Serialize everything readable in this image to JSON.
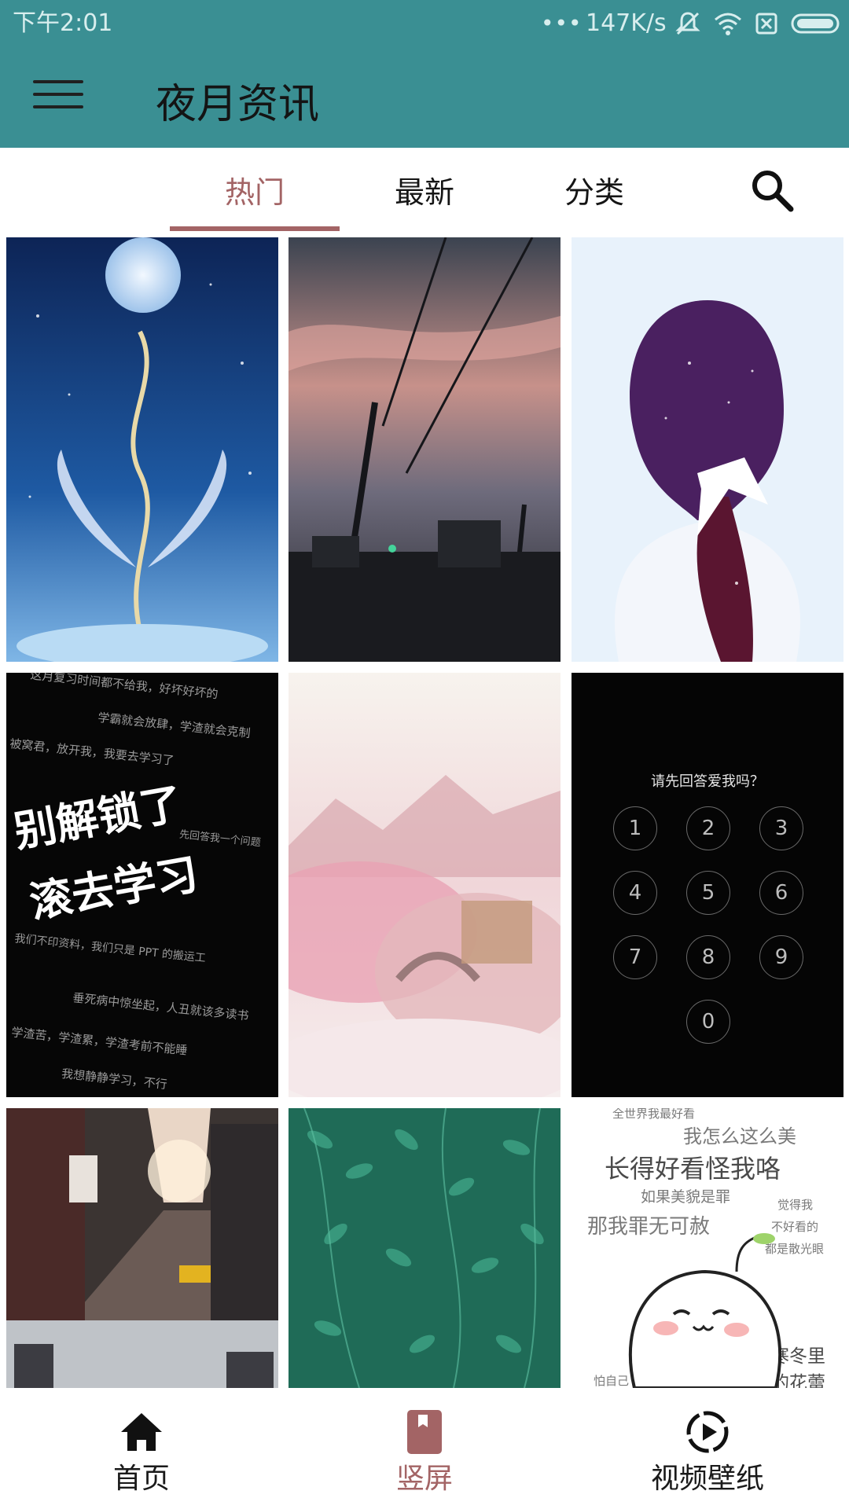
{
  "status": {
    "time": "下午2:01",
    "dots": "•••",
    "speed": "147K/s"
  },
  "app": {
    "title": "夜月资讯",
    "accent": "#a36465",
    "bar_color": "#3a8f93"
  },
  "tabs": [
    {
      "label": "热门",
      "active": true
    },
    {
      "label": "最新",
      "active": false
    },
    {
      "label": "分类",
      "active": false
    }
  ],
  "wallpapers": [
    {
      "name": "moon-angel",
      "text": []
    },
    {
      "name": "power-lines-sunset",
      "text": []
    },
    {
      "name": "girl-ribbon-hair",
      "text": []
    },
    {
      "name": "study-lock-text",
      "text": [
        "这月复习时间都不给我，好坏好坏的",
        "学霸就会放肆，学渣就会克制",
        "被窝君，放开我，我要去学习了",
        "别解锁了",
        "滚去学习",
        "先回答我一个问题",
        "我们不印资料，我们只是 PPT 的搬运工",
        "垂死病中惊坐起，人丑就该多读书",
        "学渣苦，学渣累，学渣考前不能睡",
        "我想静静学习，不行"
      ]
    },
    {
      "name": "cherry-blossom-town",
      "text": []
    },
    {
      "name": "passcode-screen",
      "prompt": "请先回答爱我吗？",
      "keys": [
        "1",
        "2",
        "3",
        "4",
        "5",
        "6",
        "7",
        "8",
        "9",
        "0"
      ]
    },
    {
      "name": "city-street",
      "text": []
    },
    {
      "name": "green-leaves",
      "text": []
    },
    {
      "name": "cute-meme",
      "text": [
        "全世界我最好看",
        "我怎么这么美",
        "长得好看怪我咯",
        "如果美貌是罪",
        "那我罪无可赦",
        "觉得我",
        "不好看的",
        "都是散光眼",
        "寒冬里",
        "的花蕾",
        "怕自己"
      ]
    }
  ],
  "bottom_nav": [
    {
      "label": "首页",
      "icon": "home-icon",
      "active": false
    },
    {
      "label": "竖屏",
      "icon": "bookmark-icon",
      "active": true
    },
    {
      "label": "视频壁纸",
      "icon": "play-circle-icon",
      "active": false
    }
  ]
}
